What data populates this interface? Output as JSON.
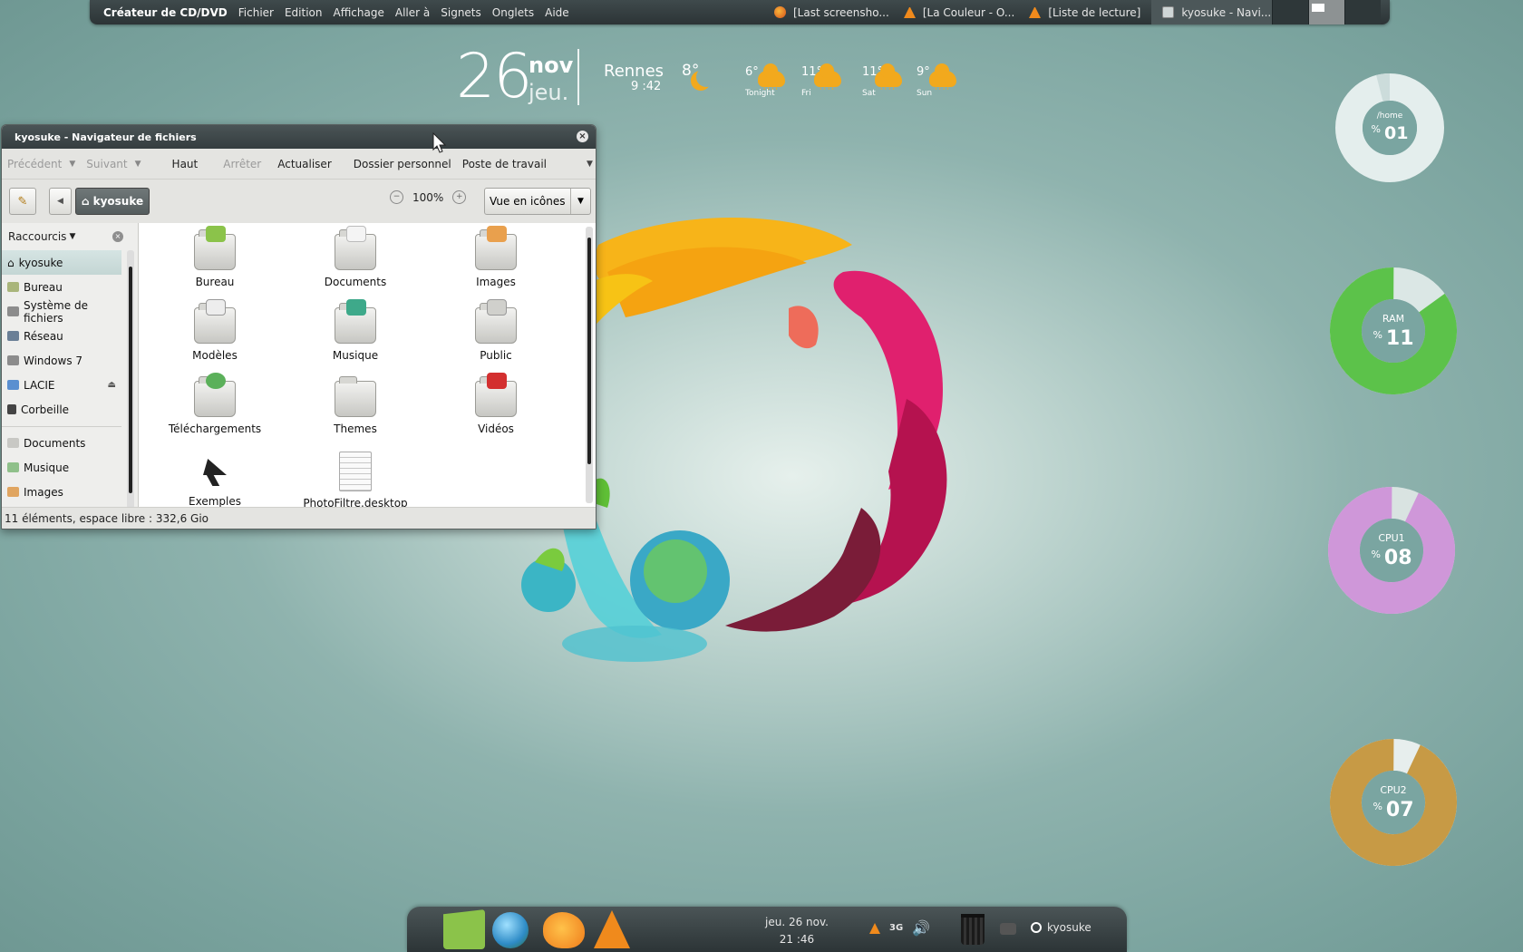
{
  "top_panel": {
    "app_name": "Créateur de CD/DVD",
    "menu": [
      "Fichier",
      "Edition",
      "Affichage",
      "Aller à",
      "Signets",
      "Onglets",
      "Aide"
    ],
    "tasks": [
      {
        "label": "[Last screensho...",
        "icon": "firefox-icon"
      },
      {
        "label": "[La Couleur - O...",
        "icon": "vlc-icon"
      },
      {
        "label": "[Liste de lecture]",
        "icon": "vlc-icon"
      },
      {
        "label": "kyosuke - Navi...",
        "icon": "file-manager-icon"
      }
    ]
  },
  "clock": {
    "day": "26",
    "month": "nov",
    "weekday": "jeu."
  },
  "weather": {
    "city": "Rennes",
    "time": "9 :42",
    "current_temp": "8°",
    "forecast": [
      {
        "temp": "6°",
        "label": "Tonight"
      },
      {
        "temp": "11°",
        "label": "Fri"
      },
      {
        "temp": "11°",
        "label": "Sat"
      },
      {
        "temp": "9°",
        "label": "Sun"
      }
    ]
  },
  "window": {
    "title": "kyosuke - Navigateur de fichiers",
    "toolbar": {
      "back": "Précédent",
      "forward": "Suivant",
      "up": "Haut",
      "stop": "Arrêter",
      "reload": "Actualiser",
      "home": "Dossier personnel",
      "computer": "Poste de travail"
    },
    "path": "kyosuke",
    "zoom": "100%",
    "view_mode": "Vue en icônes",
    "sidebar": {
      "title": "Raccourcis",
      "places": [
        {
          "label": "kyosuke",
          "selected": true
        },
        {
          "label": "Bureau"
        },
        {
          "label": "Système de fichiers"
        },
        {
          "label": "Réseau"
        },
        {
          "label": "Windows 7"
        },
        {
          "label": "LACIE",
          "eject": true
        },
        {
          "label": "Corbeille"
        }
      ],
      "bookmarks": [
        {
          "label": "Documents"
        },
        {
          "label": "Musique"
        },
        {
          "label": "Images"
        }
      ]
    },
    "files": [
      {
        "name": "Bureau",
        "icon": "folder-desktop-icon"
      },
      {
        "name": "Documents",
        "icon": "folder-documents-icon"
      },
      {
        "name": "Images",
        "icon": "folder-pictures-icon"
      },
      {
        "name": "Modèles",
        "icon": "folder-templates-icon"
      },
      {
        "name": "Musique",
        "icon": "folder-music-icon"
      },
      {
        "name": "Public",
        "icon": "folder-public-icon"
      },
      {
        "name": "Téléchargements",
        "icon": "folder-download-icon"
      },
      {
        "name": "Themes",
        "icon": "folder-icon"
      },
      {
        "name": "Vidéos",
        "icon": "folder-videos-icon"
      },
      {
        "name": "Exemples",
        "icon": "symlink-icon"
      },
      {
        "name": "PhotoFiltre.desktop",
        "icon": "text-file-icon"
      }
    ],
    "status": "11 éléments, espace libre : 332,6 Gio"
  },
  "gauges": [
    {
      "label": "/home",
      "pct_symbol": "%",
      "value": "01",
      "fraction": 0.04,
      "color": "#ccdcdb",
      "track": "#e4eeed"
    },
    {
      "label": "RAM",
      "pct_symbol": "%",
      "value": "11",
      "fraction": 0.85,
      "color": "#5cc24a",
      "track": "#dbe7e5"
    },
    {
      "label": "CPU1",
      "pct_symbol": "%",
      "value": "08",
      "fraction": 0.93,
      "color": "#cf97d9",
      "track": "#d9e3e1"
    },
    {
      "label": "CPU2",
      "pct_symbol": "%",
      "value": "07",
      "fraction": 0.93,
      "color": "#c79a45",
      "track": "#e7eeed"
    }
  ],
  "dock": {
    "date": "jeu. 26 nov.",
    "time": "21 :46",
    "user": "kyosuke",
    "network": "3G"
  }
}
